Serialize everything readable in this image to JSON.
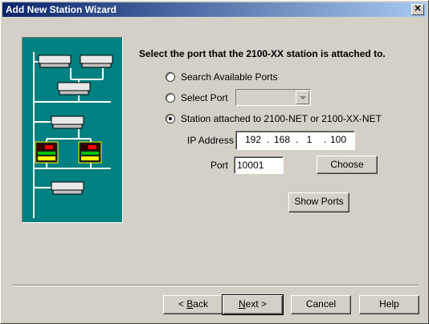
{
  "window": {
    "title": "Add New Station Wizard",
    "close_glyph": "✕"
  },
  "heading": "Select the port that the 2100-XX station is attached to.",
  "options": {
    "search": "Search Available Ports",
    "select_port": "Select Port",
    "station_net": "Station attached to 2100-NET or 2100-XX-NET",
    "selected": "station_net"
  },
  "select_port_combo": {
    "value": ""
  },
  "ip": {
    "label": "IP Address",
    "octets": [
      "192",
      "168",
      "1",
      "100"
    ]
  },
  "port": {
    "label": "Port",
    "value": "10001"
  },
  "buttons": {
    "choose": "Choose",
    "show_ports": "Show Ports",
    "back_prefix": "< ",
    "back_accel": "B",
    "back_rest": "ack",
    "next_accel": "N",
    "next_rest": "ext >",
    "cancel": "Cancel",
    "help": "Help"
  },
  "illustration": {
    "name": "network-station-diagram",
    "background": "#008080",
    "device_color": "#e8e8e8",
    "display_color": "#ff0000"
  }
}
